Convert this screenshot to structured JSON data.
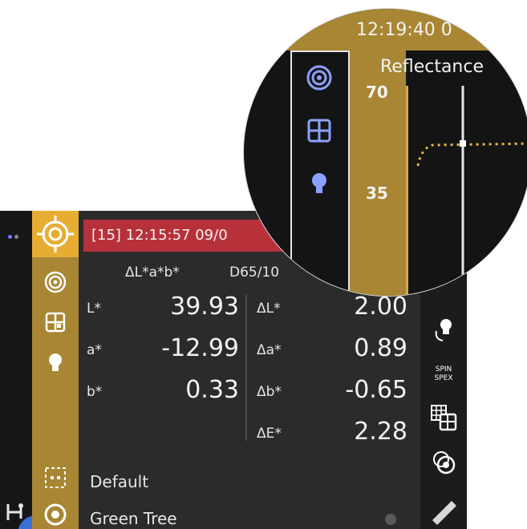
{
  "status": {
    "header": "[15] 12:15:57 09/0",
    "mode": "ΔL*a*b*",
    "illuminant": "D65/10"
  },
  "values": {
    "L_label": "L*",
    "L_value": "39.93",
    "a_label": "a*",
    "a_value": "-12.99",
    "b_label": "b*",
    "b_value": "0.33",
    "dL_label": "ΔL*",
    "dL_value": "2.00",
    "da_label": "Δa*",
    "da_value": "0.89",
    "db_label": "Δb*",
    "db_value": "-0.65",
    "dE_label": "ΔE*",
    "dE_value": "2.28"
  },
  "footer": {
    "tolerance_label": "Default",
    "standard_label": "Green Tree"
  },
  "right_bar": {
    "spin_label": "SPIN",
    "spex_label": "SPEX"
  },
  "zoom": {
    "time": "12:19:40 0",
    "title": "Reflectance",
    "y_tick_top": "70",
    "y_tick_mid": "35"
  },
  "colors": {
    "accent_gold": "#a88633",
    "highlight_orange": "#e7ad33",
    "header_red": "#b6313a",
    "background": "#2b2b2b"
  },
  "icons": [
    "target-icon",
    "spectrum-icon",
    "grid-icon",
    "bulb-icon",
    "dashed-box-icon",
    "power-icon",
    "light-toggle-icon",
    "spin-spex-icon",
    "compare-grid-icon",
    "settings-rings-icon",
    "pencil-icon"
  ]
}
